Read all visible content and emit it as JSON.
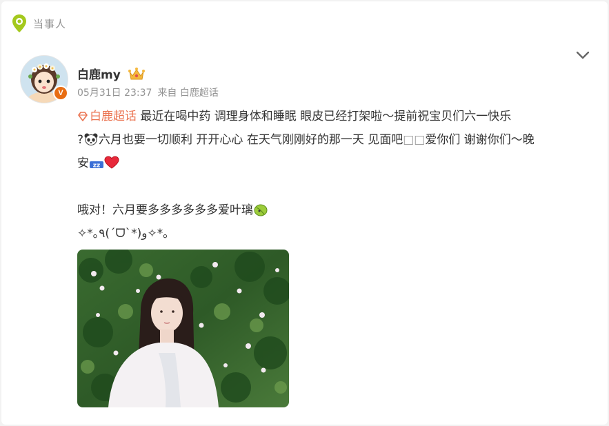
{
  "header": {
    "label": "当事人"
  },
  "post": {
    "username": "白鹿my",
    "timestamp": "05月31日 23:37",
    "source": "来自 白鹿超话",
    "topic": "白鹿超话",
    "line1_text": " 最近在喝中药 调理身体和睡眠 眼皮已经打架啦～提前祝宝贝们六一快乐",
    "line2_prefix": "?",
    "line2_text": "六月也要一切顺利 开开心心 在天气刚刚好的那一天 见面吧",
    "line2_boxes": "□□",
    "line2_suffix": "爱你们 谢谢你们～晚",
    "line3_text": "安",
    "line5_text": "哦对！六月要多多多多多多爱叶璃",
    "line6_text": "✧*｡٩(ˊᗜˋ*)و✧*｡"
  },
  "colors": {
    "topic": "#eb7350",
    "meta": "#939393",
    "pin": "#a4c91d",
    "vbadge": "#e86d12"
  },
  "icons": {
    "header": "location-pin-icon",
    "menu": "chevron-down-icon",
    "badge": "crown-vip-icon",
    "verified": "verified-v-icon",
    "topic": "diamond-topic-icon"
  }
}
